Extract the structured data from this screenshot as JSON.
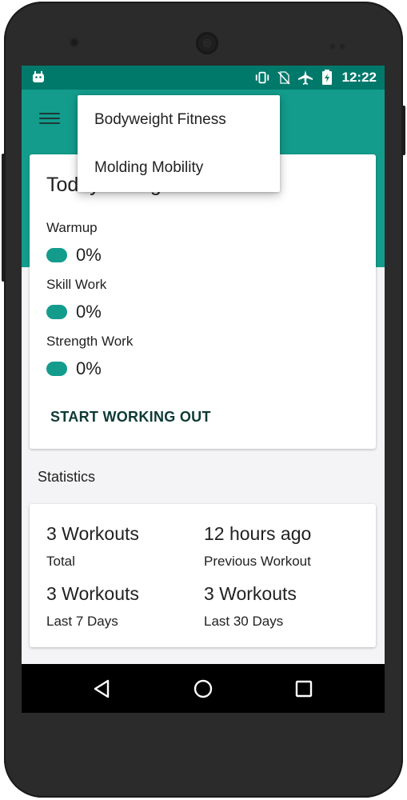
{
  "statusbar": {
    "time": "12:22",
    "icons": [
      "android-debug-icon",
      "vibrate-icon",
      "no-sim-icon",
      "airplane-icon",
      "battery-charging-icon"
    ]
  },
  "toolbar": {
    "menu_icon": "hamburger-icon"
  },
  "dropdown": {
    "items": [
      {
        "label": "Bodyweight Fitness"
      },
      {
        "label": "Molding Mobility"
      }
    ]
  },
  "progress_card": {
    "title": "Today's Progress",
    "sections": [
      {
        "label": "Warmup",
        "percent": "0%"
      },
      {
        "label": "Skill Work",
        "percent": "0%"
      },
      {
        "label": "Strength Work",
        "percent": "0%"
      }
    ],
    "action_label": "START WORKING OUT"
  },
  "statistics": {
    "heading": "Statistics",
    "items": [
      {
        "value": "3 Workouts",
        "caption": "Total"
      },
      {
        "value": "12 hours ago",
        "caption": "Previous Workout"
      },
      {
        "value": "3 Workouts",
        "caption": "Last 7 Days"
      },
      {
        "value": "3 Workouts",
        "caption": "Last 30 Days"
      }
    ]
  },
  "navbar": {
    "icons": [
      "back-icon",
      "home-icon",
      "recents-icon"
    ]
  },
  "colors": {
    "status_bar": "#00796b",
    "toolbar": "#139c8c",
    "accent": "#139c8c",
    "background": "#f4f4f6",
    "action_text": "#0e3a35"
  }
}
